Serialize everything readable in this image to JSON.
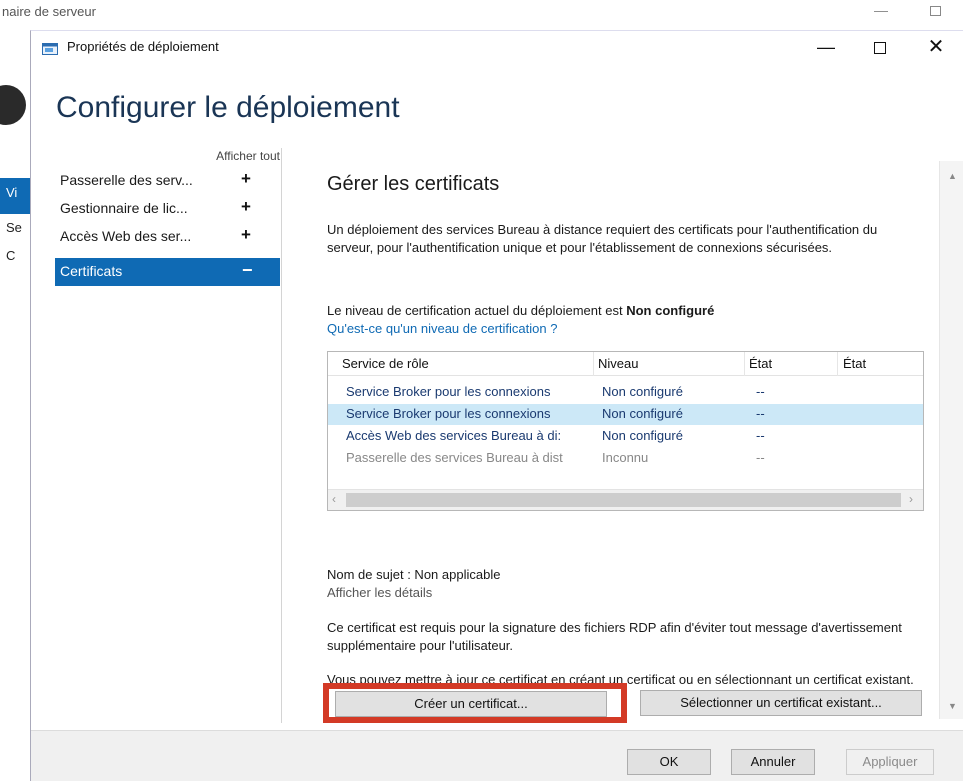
{
  "background": {
    "title": "naire de serveur",
    "sidebar_letters": [
      "Vi",
      "Se",
      "C"
    ]
  },
  "dialog": {
    "title": "Propriétés de déploiement",
    "heading": "Configurer le déploiement"
  },
  "nav": {
    "show_all": "Afficher tout",
    "items": [
      {
        "label": "Passerelle des serv...",
        "symbol": "+"
      },
      {
        "label": "Gestionnaire de lic...",
        "symbol": "+"
      },
      {
        "label": "Accès Web des ser...",
        "symbol": "+"
      },
      {
        "label": "Certificats",
        "symbol": "−"
      }
    ]
  },
  "content": {
    "title": "Gérer les certificats",
    "description": "Un déploiement des services Bureau à distance requiert des certificats pour l'authentification du serveur, pour l'authentification unique et pour l'établissement de connexions sécurisées.",
    "level_prefix": "Le niveau de certification actuel du déploiement est ",
    "level_value": "Non configuré",
    "level_link": "Qu'est-ce qu'un niveau de certification ?",
    "table": {
      "headers": [
        "Service de rôle",
        "Niveau",
        "État",
        "État"
      ],
      "rows": [
        [
          "Service Broker pour les connexions",
          "Non configuré",
          "--",
          ""
        ],
        [
          "Service Broker pour les connexions",
          "Non configuré",
          "--",
          ""
        ],
        [
          "Accès Web des services Bureau à di:",
          "Non configuré",
          "--",
          ""
        ],
        [
          "Passerelle des services Bureau à dist",
          "Inconnu",
          "--",
          ""
        ]
      ],
      "selected_row": 1
    },
    "subject_name": "Nom de sujet : Non applicable",
    "show_details": "Afficher les détails",
    "para_rdp": "Ce certificat est requis pour la signature des fichiers RDP afin d'éviter tout message d'avertissement supplémentaire pour l'utilisateur.",
    "para_update": "Vous pouvez mettre à jour ce certificat en créant un certificat ou en sélectionnant un certificat existant.",
    "create_button": "Créer un certificat...",
    "select_button": "Sélectionner un certificat existant..."
  },
  "footer": {
    "ok": "OK",
    "cancel": "Annuler",
    "apply": "Appliquer"
  },
  "colors": {
    "accent": "#0f6ab4",
    "highlight_box": "#d33a26",
    "selected_row": "#cce8f7"
  }
}
